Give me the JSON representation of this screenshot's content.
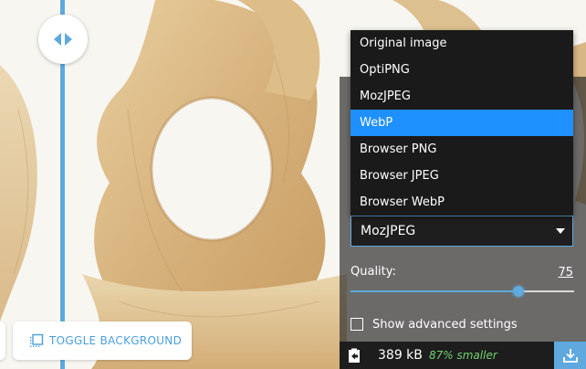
{
  "accent_color": "#5fa9de",
  "divider": {
    "icon": "left-right-arrows-icon"
  },
  "toolbar": {
    "toggle_background_label": "TOGGLE BACKGROUND",
    "toggle_background_icon": "background-toggle-icon"
  },
  "options": {
    "method_dropdown": {
      "open": true,
      "selected_value": "MozJPEG",
      "highlighted_option": "WebP",
      "options": [
        "Original image",
        "OptiPNG",
        "MozJPEG",
        "WebP",
        "Browser PNG",
        "Browser JPEG",
        "Browser WebP"
      ]
    },
    "quality": {
      "label": "Quality:",
      "value": "75",
      "fraction": 0.75
    },
    "advanced": {
      "label": "Show advanced settings",
      "checked": false
    }
  },
  "results": {
    "size": "389 kB",
    "diff": "87% smaller",
    "diff_color": "#6ed36e",
    "icon": "copy-to-other-side-icon",
    "download_icon": "download-icon"
  }
}
